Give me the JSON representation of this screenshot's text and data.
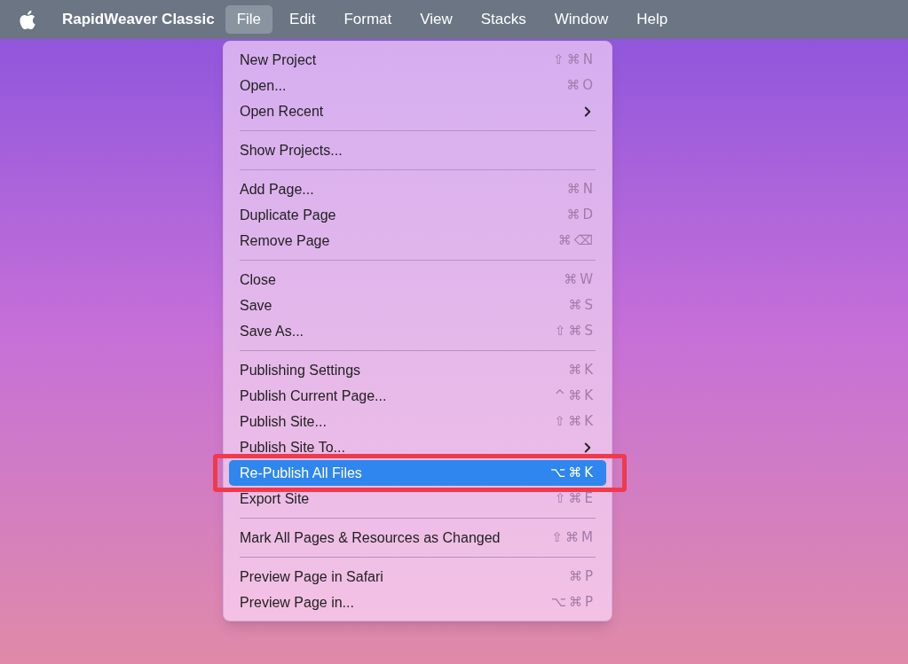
{
  "menu_bar": {
    "app_name": "RapidWeaver Classic",
    "items": [
      {
        "label": "File",
        "selected": true
      },
      {
        "label": "Edit",
        "selected": false
      },
      {
        "label": "Format",
        "selected": false
      },
      {
        "label": "View",
        "selected": false
      },
      {
        "label": "Stacks",
        "selected": false
      },
      {
        "label": "Window",
        "selected": false
      },
      {
        "label": "Help",
        "selected": false
      }
    ]
  },
  "menu": {
    "sections": [
      [
        {
          "label": "New Project",
          "shortcut": "⇧⌘N",
          "selected": false
        },
        {
          "label": "Open...",
          "shortcut": "⌘O",
          "selected": false
        },
        {
          "label": "Open Recent",
          "submenu": true,
          "selected": false
        }
      ],
      [
        {
          "label": "Show Projects...",
          "selected": false
        }
      ],
      [
        {
          "label": "Add Page...",
          "shortcut": "⌘N",
          "selected": false
        },
        {
          "label": "Duplicate Page",
          "shortcut": "⌘D",
          "selected": false
        },
        {
          "label": "Remove Page",
          "shortcut": "⌘⌫",
          "selected": false
        }
      ],
      [
        {
          "label": "Close",
          "shortcut": "⌘W",
          "selected": false
        },
        {
          "label": "Save",
          "shortcut": "⌘S",
          "selected": false
        },
        {
          "label": "Save As...",
          "shortcut": "⇧⌘S",
          "selected": false
        }
      ],
      [
        {
          "label": "Publishing Settings",
          "shortcut": "⌘K",
          "selected": false
        },
        {
          "label": "Publish Current Page...",
          "shortcut": "^⌘K",
          "selected": false
        },
        {
          "label": "Publish Site...",
          "shortcut": "⇧⌘K",
          "selected": false
        },
        {
          "label": "Publish Site To...",
          "submenu": true,
          "selected": false
        },
        {
          "label": "Re-Publish All Files",
          "shortcut": "⌥⌘K",
          "selected": true,
          "annotated": true
        },
        {
          "label": "Export Site",
          "shortcut": "⇧⌘E",
          "selected": false
        }
      ],
      [
        {
          "label": "Mark All Pages & Resources as Changed",
          "shortcut": "⇧⌘M",
          "selected": false
        }
      ],
      [
        {
          "label": "Preview Page in Safari",
          "shortcut": "⌘P",
          "selected": false
        },
        {
          "label": "Preview Page in...",
          "shortcut": "⌥⌘P",
          "selected": false
        }
      ]
    ]
  }
}
